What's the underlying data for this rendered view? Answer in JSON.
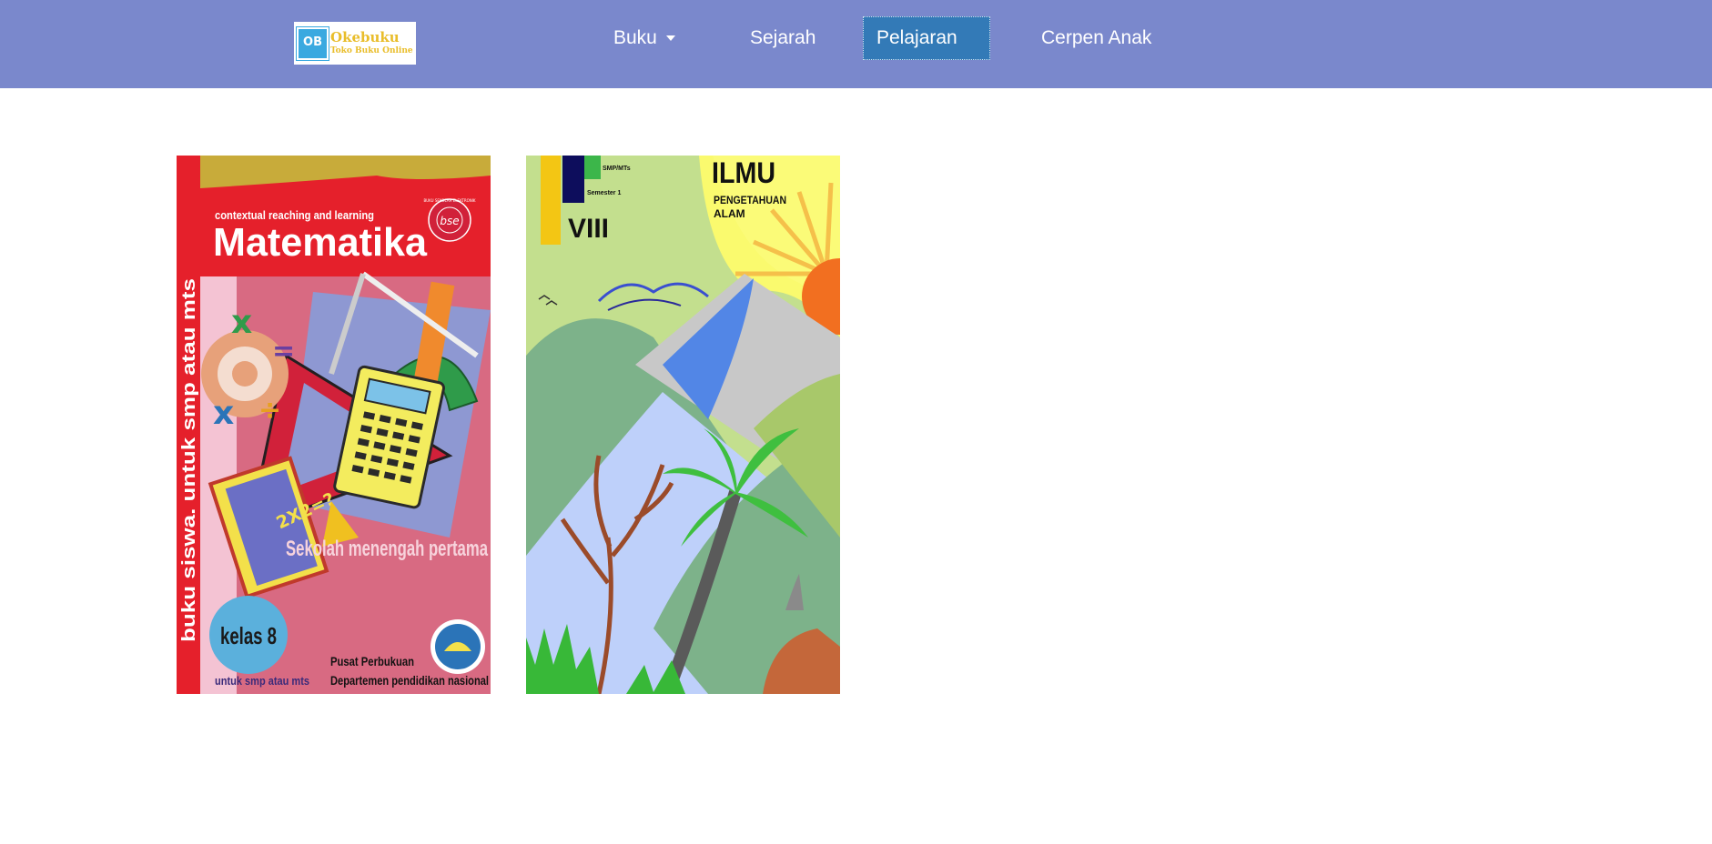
{
  "navbar": {
    "logo": {
      "badge": "OB",
      "title": "Okebuku",
      "subtitle": "Toko Buku Online"
    },
    "items": [
      {
        "label": "Buku",
        "has_dropdown": true
      },
      {
        "label": "Sejarah"
      },
      {
        "label": "Pelajaran",
        "active": true
      },
      {
        "label": "Cerpen Anak"
      }
    ],
    "colors": {
      "background": "#7a88cc",
      "active": "#337ab7"
    }
  },
  "books": [
    {
      "top_text": "contextual reaching and learning",
      "title": "Matematika",
      "badge": "bse",
      "badge_ring": "BUKU SEKOLAH ELEKTRONIK",
      "side_text": "buku siswa. untuk smp atau mts",
      "formula": "2X2=?",
      "school": "Sekolah menengah pertama",
      "grade": "kelas 8",
      "grade_sub": "untuk smp atau mts",
      "publisher_1": "Pusat Perbukuan",
      "publisher_2": "Departemen pendidikan nasional"
    },
    {
      "level": "SMP/MTs",
      "semester": "Semester 1",
      "grade": "VIII",
      "title": "ILMU",
      "subtitle_1": "PENGETAHUAN",
      "subtitle_2": "ALAM"
    }
  ]
}
